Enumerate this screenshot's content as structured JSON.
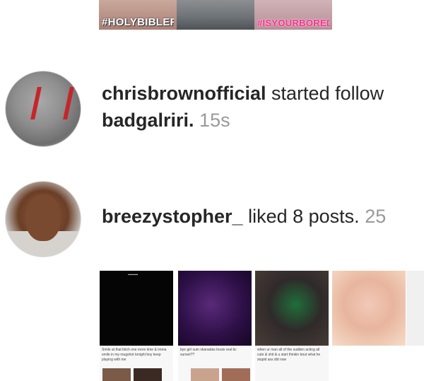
{
  "top_strip": {
    "captions": [
      "#HOLYBIBLEFT",
      "",
      "#ISYOURBOREDF"
    ]
  },
  "activity": [
    {
      "username": "chrisbrownofficial",
      "action": " started follow",
      "target": "badgalriri.",
      "time": "15s"
    },
    {
      "username": "breezystopher_",
      "action": " liked 8 posts.",
      "time": "25"
    }
  ],
  "posts": {
    "captions": [
      "Smile at that bitch one more time & imma smile in my mugshot tonight boy keep playing with me",
      "bye girl sum skanadas bouts real bc sunset??",
      "when ur man all of the sudden acting all cute & shit & u start thinkin bout what he stupid ass did now",
      ""
    ]
  }
}
